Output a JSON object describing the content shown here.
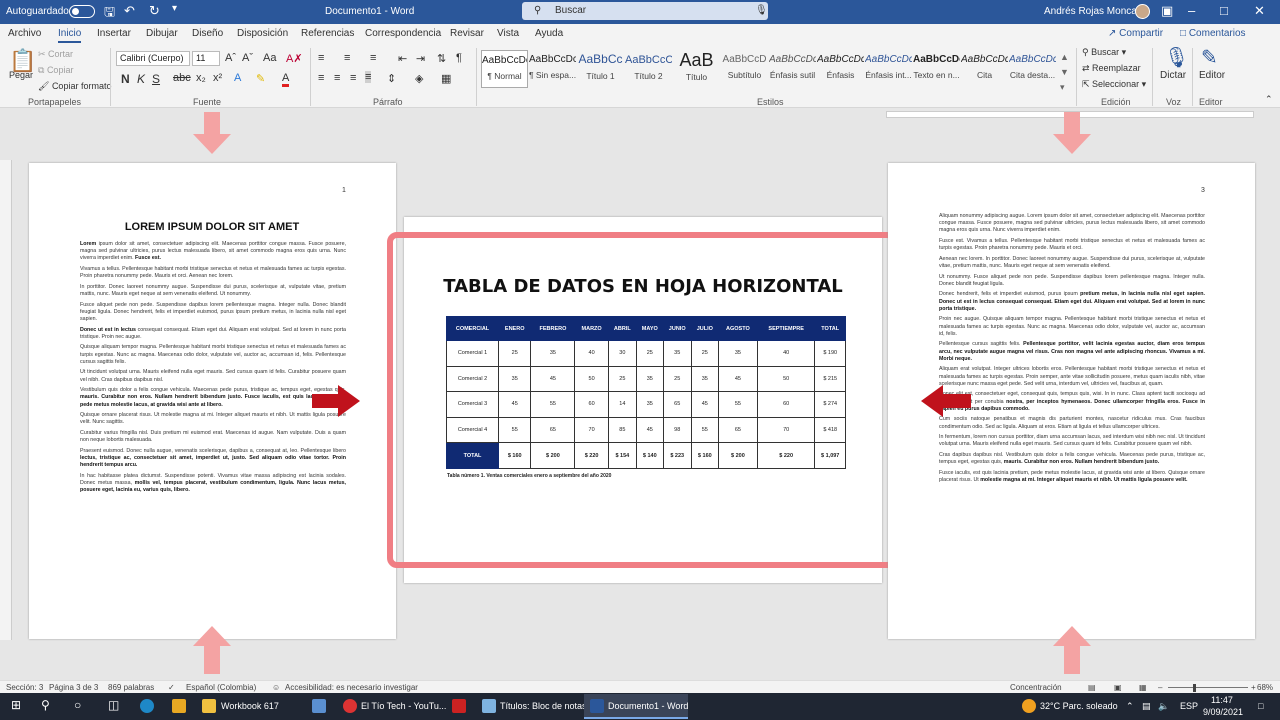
{
  "titlebar": {
    "autosave": "Autoguardado",
    "doc": "Documento1 - Word",
    "search": "Buscar",
    "user": "Andrés Rojas Moncada"
  },
  "tabs": [
    "Archivo",
    "Inicio",
    "Insertar",
    "Dibujar",
    "Diseño",
    "Disposición",
    "Referencias",
    "Correspondencia",
    "Revisar",
    "Vista",
    "Ayuda"
  ],
  "share": {
    "share": "Compartir",
    "comments": "Comentarios"
  },
  "ribbon": {
    "paste": "Pegar",
    "cut": "Cortar",
    "copy": "Copiar",
    "format": "Copiar formato",
    "clipboard": "Portapapeles",
    "font_name": "Calibri (Cuerpo)",
    "font_size": "11",
    "font_group": "Fuente",
    "para_group": "Párrafo",
    "styles_group": "Estilos",
    "styles": [
      {
        "pv": "AaBbCcDc",
        "nm": "¶ Normal"
      },
      {
        "pv": "AaBbCcDc",
        "nm": "¶ Sin espa..."
      },
      {
        "pv": "AaBbCc",
        "nm": "Título 1"
      },
      {
        "pv": "AaBbCcC",
        "nm": "Título 2"
      },
      {
        "pv": "AaB",
        "nm": "Título"
      },
      {
        "pv": "AaBbCcD",
        "nm": "Subtítulo"
      },
      {
        "pv": "AaBbCcDc",
        "nm": "Énfasis sutil"
      },
      {
        "pv": "AaBbCcDc",
        "nm": "Énfasis"
      },
      {
        "pv": "AaBbCcDc",
        "nm": "Énfasis int..."
      },
      {
        "pv": "AaBbCcDc",
        "nm": "Texto en n..."
      },
      {
        "pv": "AaBbCcDc",
        "nm": "Cita"
      },
      {
        "pv": "AaBbCcDc",
        "nm": "Cita desta..."
      }
    ],
    "find": "Buscar",
    "replace": "Reemplazar",
    "select": "Seleccionar",
    "edit_group": "Edición",
    "dictate": "Dictar",
    "voice_group": "Voz",
    "editor": "Editor",
    "editor_group": "Editor"
  },
  "page1": {
    "number": "1",
    "title": "LOREM IPSUM DOLOR SIT AMET",
    "paragraphs": [
      [
        "Lorem",
        " ipsum dolor sit amet, consectetuer adipiscing elit. Maecenas porttitor congue massa. Fusce posuere, magna sed pulvinar ultricies, purus lectus malesuada libero, sit amet commodo magna eros quis urna. Nunc viverra imperdiet enim. ",
        "Fusce est."
      ],
      [
        "",
        "Vivamus a tellus. Pellentesque habitant morbi tristique senectus et netus et malesuada fames ac turpis egestas. Proin pharetra nonummy pede. Mauris et orci. Aenean nec lorem.",
        ""
      ],
      [
        "",
        "In porttitor. Donec laoreet nonummy augue. Suspendisse dui purus, scelerisque at, vulputate vitae, pretium mattis, nunc. Mauris eget neque at sem venenatis eleifend. Ut nonummy.",
        ""
      ],
      [
        "",
        "Fusce aliquet pede non pede. Suspendisse dapibus lorem pellentesque magna. Integer nulla. Donec blandit feugiat ligula. Donec hendrerit, felis et imperdiet euismod, purus ipsum pretium metus, in lacinia nulla nisl eget sapien.",
        ""
      ],
      [
        "Donec ut est in lectus",
        " consequat consequat. Etiam eget dui. Aliquam erat volutpat. Sed at lorem in nunc porta tristique. Proin nec augue.",
        ""
      ],
      [
        "",
        "Quisque aliquam tempor magna. Pellentesque habitant morbi tristique senectus et netus et malesuada fames ac turpis egestas. Nunc ac magna. Maecenas odio dolor, vulputate vel, auctor ac, accumsan id, felis. Pellentesque cursus sagittis felis.",
        ""
      ],
      [
        "",
        "Ut tincidunt volutpat urna. Mauris eleifend nulla eget mauris. Sed cursus quam id felis. Curabitur posuere quam vel nibh. Cras dapibus dapibus nisl.",
        ""
      ],
      [
        "",
        "Vestibulum quis dolor a felis congue vehicula. Maecenas pede purus, tristique ac, tempus eget, egestas quis, ",
        "mauris. Curabitur non eros. Nullam hendrerit bibendum justo. Fusce iaculis, est quis lacinia pretium, pede metus molestie lacus, at gravida wisi ante at libero."
      ],
      [
        "",
        "Quisque ornare placerat risus. Ut molestie magna at mi. Integer aliquet mauris et nibh. Ut mattis ligula posuere velit. Nunc sagittis.",
        ""
      ],
      [
        "",
        "Curabitur varius fringilla nisl. Duis pretium mi euismod erat. Maecenas id augue. Nam vulputate. Duis a quam non neque lobortis malesuada.",
        ""
      ],
      [
        "",
        "Praesent euismod. Donec nulla augue, venenatis scelerisque, dapibus a, consequat at, leo. Pellentesque libero ",
        "lectus, tristique ac, consectetuer sit amet, imperdiet ut, justo. Sed aliquam odio vitae tortor. Proin hendrerit tempus arcu."
      ],
      [
        "",
        "In hac habitasse platea dictumst. Suspendisse potenti. Vivamus vitae massa adipiscing est lacinia sodales. Donec metus massa, ",
        "mollis vel, tempus placerat, vestibulum condimentum, ligula. Nunc lacus metus, posuere eget, lacinia eu, varius quis, libero."
      ]
    ]
  },
  "page2": {
    "title": "TABLA DE DATOS EN HOJA HORIZONTAL",
    "headers": [
      "COMERCIAL",
      "ENERO",
      "FEBRERO",
      "MARZO",
      "ABRIL",
      "MAYO",
      "JUNIO",
      "JULIO",
      "AGOSTO",
      "SEPTIEMPRE",
      "TOTAL"
    ],
    "rows": [
      [
        "Comercial 1",
        "25",
        "35",
        "40",
        "30",
        "25",
        "35",
        "25",
        "35",
        "40",
        "$ 190"
      ],
      [
        "Comercial 2",
        "35",
        "45",
        "50",
        "25",
        "35",
        "25",
        "35",
        "45",
        "50",
        "$ 215"
      ],
      [
        "Comercial 3",
        "45",
        "55",
        "60",
        "14",
        "35",
        "65",
        "45",
        "55",
        "60",
        "$ 274"
      ],
      [
        "Comercial 4",
        "55",
        "65",
        "70",
        "85",
        "45",
        "98",
        "55",
        "65",
        "70",
        "$ 418"
      ]
    ],
    "total": [
      "TOTAL",
      "$ 160",
      "$ 200",
      "$ 220",
      "$ 154",
      "$ 140",
      "$ 223",
      "$ 160",
      "$ 200",
      "$ 220",
      "$ 1,097"
    ],
    "caption": "Tabla número 1. Ventas comerciales enero a septiembre del año 2020"
  },
  "page3": {
    "number": "3",
    "paragraphs": [
      [
        "",
        "Aliquam nonummy adipiscing augue. Lorem ipsum dolor sit amet, consectetuer adipiscing elit. Maecenas porttitor congue massa. Fusce posuere, magna sed pulvinar ultricies, purus lectus malesuada libero, sit amet commodo magna eros quis urna. Nunc viverra imperdiet enim.",
        ""
      ],
      [
        "",
        "Fusce est. Vivamus a tellus. Pellentesque habitant morbi tristique senectus et netus et malesuada fames ac turpis egestas. Proin pharetra nonummy pede. Mauris et orci.",
        ""
      ],
      [
        "",
        "Aenean nec lorem. In porttitor. Donec laoreet nonummy augue. Suspendisse dui purus, scelerisque at, vulputate vitae, pretium mattis, nunc. Mauris eget neque at sem venenatis eleifend.",
        ""
      ],
      [
        "",
        "Ut nonummy. Fusce aliquet pede non pede. Suspendisse dapibus lorem pellentesque magna. Integer nulla. Donec blandit feugiat ligula.",
        ""
      ],
      [
        "",
        "Donec hendrerit, felis et imperdiet euismod, purus ipsum ",
        "pretium metus, in lacinia nulla nisl eget sapien. Donec ut est in lectus consequat consequat. Etiam eget dui. Aliquam erat volutpat. Sed at lorem in nunc porta tristique."
      ],
      [
        "",
        "Proin nec augue. Quisque aliquam tempor magna. Pellentesque habitant morbi tristique senectus et netus et malesuada fames ac turpis egestas. Nunc ac magna. Maecenas odio dolor, vulputate vel, auctor ac, accumsan id, felis.",
        ""
      ],
      [
        "",
        "Pellentesque cursus sagittis felis. ",
        "Pellentesque porttitor, velit lacinia egestas auctor, diam eros tempus arcu, nec vulputate augue magna vel risus. Cras non magna vel ante adipiscing rhoncus. Vivamus a mi. Morbi neque."
      ],
      [
        "",
        "Aliquam erat volutpat. Integer ultrices lobortis eros. Pellentesque habitant morbi tristique senectus et netus et malesuada fames ac turpis egestas. Proin semper, ante vitae sollicitudin posuere, metus quam iaculis nibh, vitae scelerisque nunc massa eget pede. Sed velit urna, interdum vel, ultricies vel, faucibus at, quam.",
        ""
      ],
      [
        "",
        "Donec elit est, consectetuer eget, consequat quis, tempus quis, wisi. In in nunc. Class aptent taciti sociosqu ad litora torquent per conubia ",
        "nostra, per inceptos hymenaeos. Donec ullamcorper fringilla eros. Fusce in sapien eu purus dapibus commodo."
      ],
      [
        "",
        "Cum sociis natoque penatibus et magnis dis parturient montes, nascetur ridiculus mus. Cras faucibus condimentum odio. Sed ac ligula. Aliquam at eros. Etiam at ligula et tellus ullamcorper ultrices.",
        ""
      ],
      [
        "",
        "In fermentum, lorem non cursus porttitor, diam urna accumsan lacus, sed interdum wisi nibh nec nisl. Ut tincidunt volutpat urna. Mauris eleifend nulla eget mauris. Sed cursus quam id felis. Curabitur posuere quam vel nibh.",
        ""
      ],
      [
        "",
        "Cras dapibus dapibus nisl. Vestibulum quis dolor a felis congue vehicula. Maecenas pede purus, tristique ac, tempus eget, egestas quis, ",
        "mauris. Curabitur non eros. Nullam hendrerit bibendum justo."
      ],
      [
        "",
        "Fusce iaculis, est quis lacinia pretium, pede metus molestie lacus, at gravida wisi ante at libero. Quisque ornare placerat risus. Ut ",
        "molestie magna at mi. Integer aliquet mauris et nibh. Ut mattis ligula posuere velit."
      ]
    ]
  },
  "status": {
    "section": "Sección: 3",
    "page": "Página 3 de 3",
    "words": "869 palabras",
    "lang": "Español (Colombia)",
    "access": "Accesibilidad: es necesario investigar",
    "focus": "Concentración",
    "zoom": "68%"
  },
  "taskbar": {
    "apps": [
      "Workbook 617",
      "El Tío Tech - YouTu...",
      "Títulos: Bloc de notas",
      "Documento1 - Word"
    ],
    "weather": "32°C  Parc. soleado",
    "lang": "ESP",
    "time": "11:47",
    "date": "9/09/2021"
  }
}
